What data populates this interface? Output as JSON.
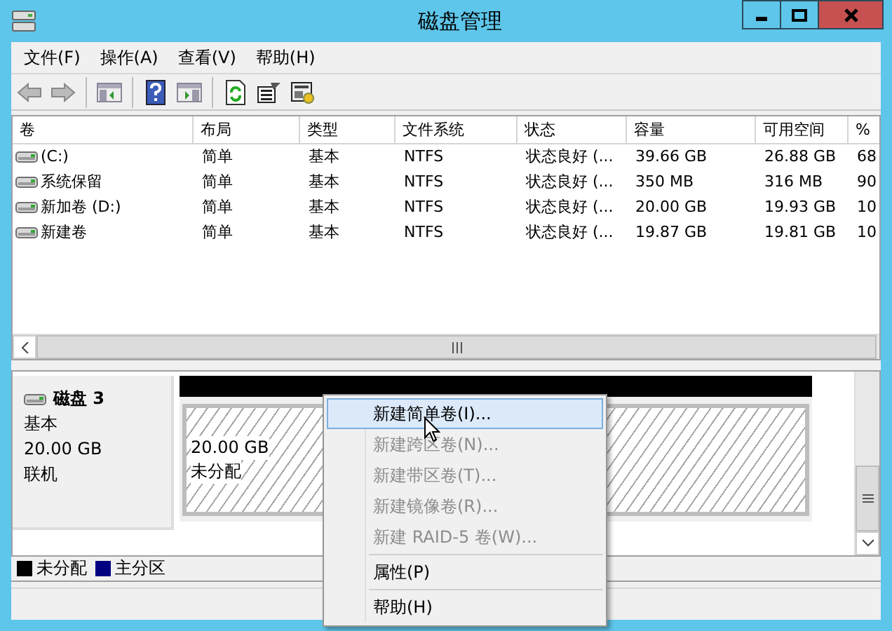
{
  "window": {
    "title": "磁盘管理"
  },
  "menu_bar": [
    "文件(F)",
    "操作(A)",
    "查看(V)",
    "帮助(H)"
  ],
  "table": {
    "columns": [
      "卷",
      "布局",
      "类型",
      "文件系统",
      "状态",
      "容量",
      "可用空间",
      "%"
    ],
    "rows": [
      [
        "(C:)",
        "简单",
        "基本",
        "NTFS",
        "状态良好 (...",
        "39.66 GB",
        "26.88 GB",
        "68"
      ],
      [
        "系统保留",
        "简单",
        "基本",
        "NTFS",
        "状态良好 (...",
        "350 MB",
        "316 MB",
        "90"
      ],
      [
        "新加卷 (D:)",
        "简单",
        "基本",
        "NTFS",
        "状态良好 (...",
        "20.00 GB",
        "19.93 GB",
        "10"
      ],
      [
        "新建卷",
        "简单",
        "基本",
        "NTFS",
        "状态良好 (...",
        "19.87 GB",
        "19.81 GB",
        "10"
      ]
    ]
  },
  "disk": {
    "name": "磁盘 3",
    "type": "基本",
    "size": "20.00 GB",
    "status": "联机",
    "partitions": [
      {
        "kind": "unallocated",
        "size": "20.00 GB",
        "label": "未分配"
      }
    ]
  },
  "legend": [
    {
      "label": "未分配",
      "color": "#000000"
    },
    {
      "label": "主分区",
      "color": "#000080"
    }
  ],
  "context_menu": [
    {
      "kind": "item",
      "label": "新建简单卷(I)...",
      "selected": true,
      "disabled": false
    },
    {
      "kind": "item",
      "label": "新建跨区卷(N)...",
      "selected": false,
      "disabled": true
    },
    {
      "kind": "item",
      "label": "新建带区卷(T)...",
      "selected": false,
      "disabled": true
    },
    {
      "kind": "item",
      "label": "新建镜像卷(R)...",
      "selected": false,
      "disabled": true
    },
    {
      "kind": "item",
      "label": "新建 RAID-5 卷(W)...",
      "selected": false,
      "disabled": true
    },
    {
      "kind": "separator"
    },
    {
      "kind": "item",
      "label": "属性(P)",
      "selected": false,
      "disabled": false
    },
    {
      "kind": "separator"
    },
    {
      "kind": "item",
      "label": "帮助(H)",
      "selected": false,
      "disabled": false
    }
  ]
}
